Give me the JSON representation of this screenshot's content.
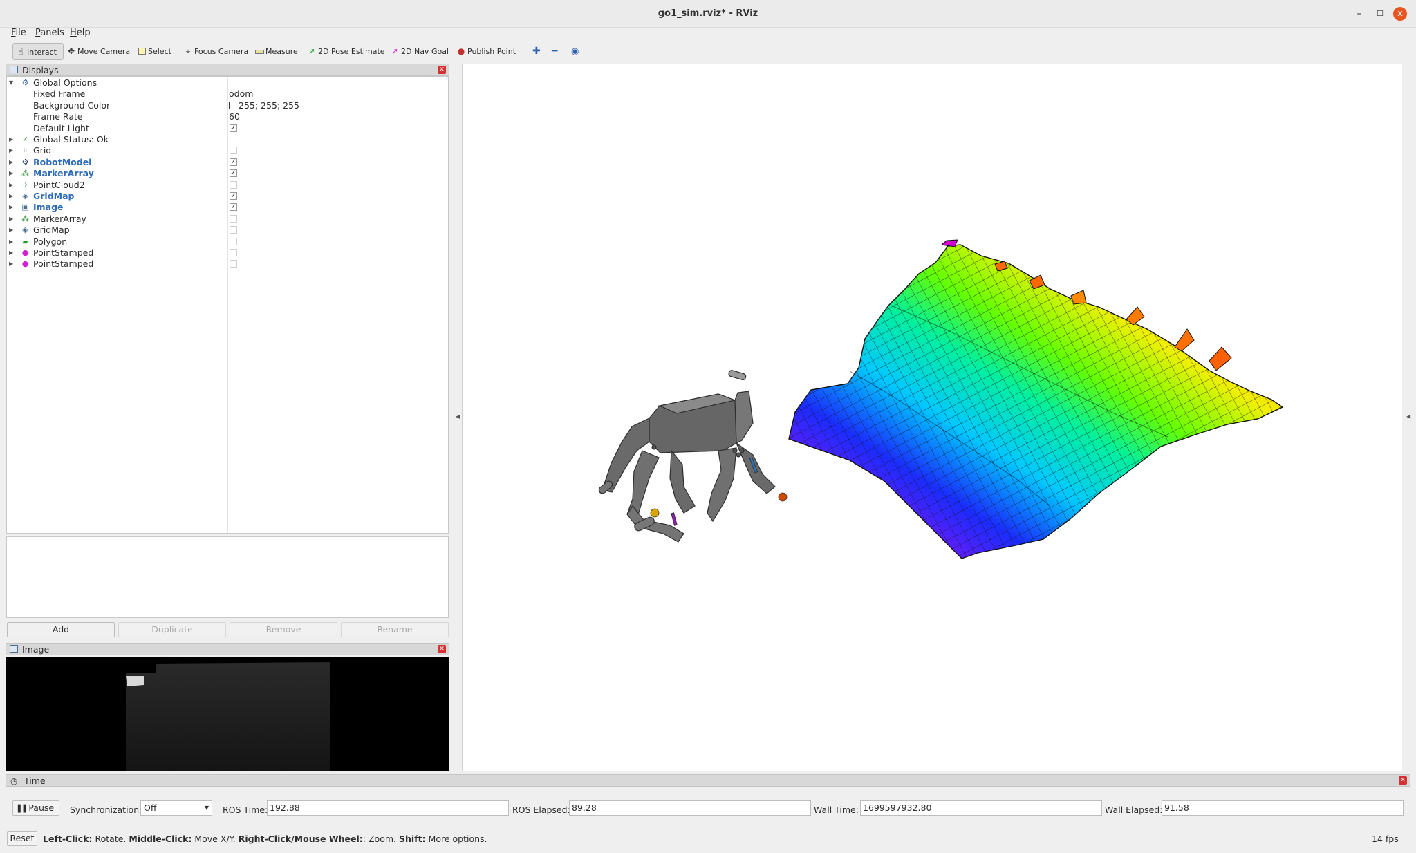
{
  "window": {
    "title": "go1_sim.rviz* - RViz"
  },
  "menu": {
    "items": [
      {
        "underline": "F",
        "rest": "ile"
      },
      {
        "underline": "P",
        "rest": "anels"
      },
      {
        "underline": "H",
        "rest": "elp"
      }
    ]
  },
  "toolbar": {
    "tools": [
      {
        "label": "Interact",
        "icon": "hand-icon"
      },
      {
        "label": "Move Camera",
        "icon": "move-camera-icon"
      },
      {
        "label": "Select",
        "icon": "select-box-icon"
      },
      {
        "label": "Focus Camera",
        "icon": "crosshair-icon"
      },
      {
        "label": "Measure",
        "icon": "ruler-icon"
      },
      {
        "label": "2D Pose Estimate",
        "icon": "green-arrow-icon"
      },
      {
        "label": "2D Nav Goal",
        "icon": "magenta-arrow-icon"
      },
      {
        "label": "Publish Point",
        "icon": "pin-icon"
      }
    ],
    "extra_icons": [
      "plus-icon",
      "minus-icon",
      "eye-icon"
    ]
  },
  "displays": {
    "title": "Displays",
    "global_options": {
      "label": "Global Options",
      "fixed_frame_label": "Fixed Frame",
      "fixed_frame": "odom",
      "background_color_label": "Background Color",
      "background_color": "255; 255; 255",
      "frame_rate_label": "Frame Rate",
      "frame_rate": "60",
      "default_light_label": "Default Light",
      "default_light": true
    },
    "global_status": "Global Status: Ok",
    "items": [
      {
        "name": "Grid",
        "enabled": false,
        "highlight": false,
        "icon": "grid-icon"
      },
      {
        "name": "RobotModel",
        "enabled": true,
        "highlight": true,
        "icon": "robot-icon"
      },
      {
        "name": "MarkerArray",
        "enabled": true,
        "highlight": true,
        "icon": "marker-icon"
      },
      {
        "name": "PointCloud2",
        "enabled": false,
        "highlight": false,
        "icon": "pointcloud-icon"
      },
      {
        "name": "GridMap",
        "enabled": true,
        "highlight": true,
        "icon": "gridmap-icon"
      },
      {
        "name": "Image",
        "enabled": true,
        "highlight": true,
        "icon": "image-icon"
      },
      {
        "name": "MarkerArray",
        "enabled": false,
        "highlight": false,
        "icon": "marker-icon"
      },
      {
        "name": "GridMap",
        "enabled": false,
        "highlight": false,
        "icon": "gridmap-icon"
      },
      {
        "name": "Polygon",
        "enabled": false,
        "highlight": false,
        "icon": "polygon-icon"
      },
      {
        "name": "PointStamped",
        "enabled": false,
        "highlight": false,
        "icon": "point-icon"
      },
      {
        "name": "PointStamped",
        "enabled": false,
        "highlight": false,
        "icon": "point-icon"
      }
    ],
    "buttons": {
      "add": "Add",
      "duplicate": "Duplicate",
      "remove": "Remove",
      "rename": "Rename"
    }
  },
  "image_panel": {
    "title": "Image"
  },
  "time_panel": {
    "title": "Time",
    "pause": "Pause",
    "sync_label": "Synchronization:",
    "sync_value": "Off",
    "ros_time_label": "ROS Time:",
    "ros_time": "192.88",
    "ros_elapsed_label": "ROS Elapsed:",
    "ros_elapsed": "89.28",
    "wall_time_label": "Wall Time:",
    "wall_time": "1699597932.80",
    "wall_elapsed_label": "Wall Elapsed:",
    "wall_elapsed": "91.58"
  },
  "status": {
    "reset": "Reset",
    "hints": [
      {
        "key": "Left-Click:",
        "desc": " Rotate. "
      },
      {
        "key": "Middle-Click:",
        "desc": " Move X/Y. "
      },
      {
        "key": "Right-Click/Mouse Wheel:",
        "desc": ": Zoom. "
      },
      {
        "key": "Shift:",
        "desc": " More options."
      }
    ],
    "fps": "14 fps"
  }
}
